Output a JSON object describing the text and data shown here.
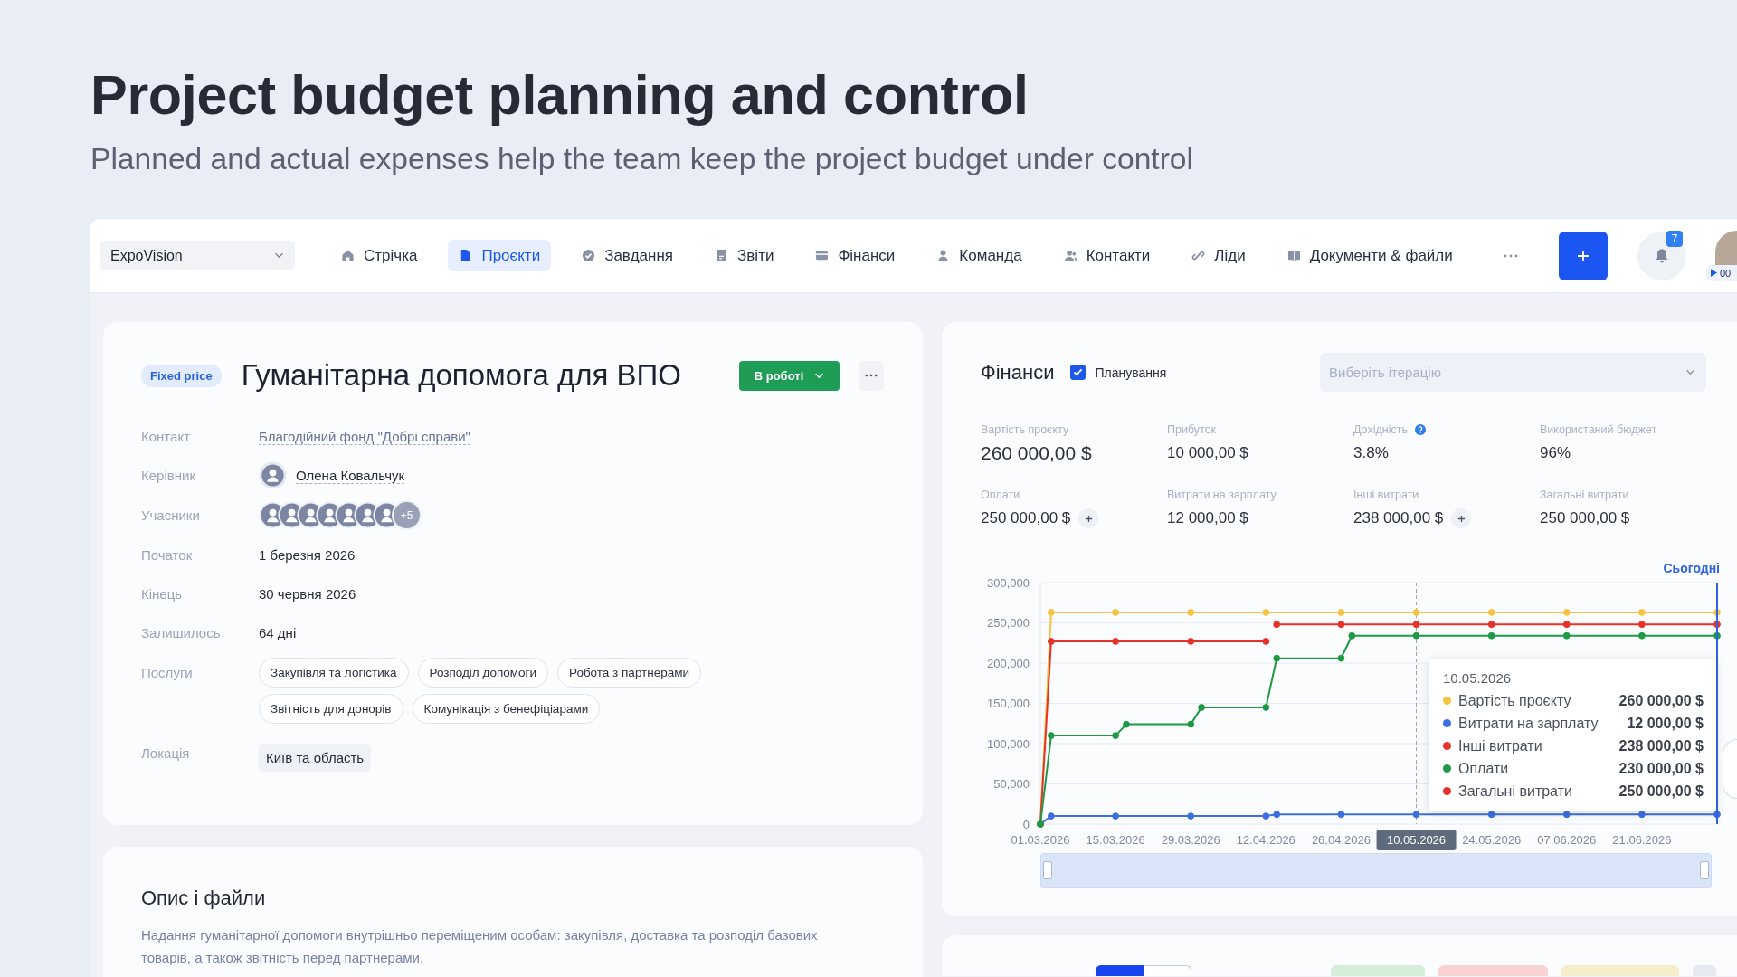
{
  "page": {
    "title": "Project budget planning and control",
    "subtitle": "Planned and actual expenses help the team keep the project budget under control"
  },
  "nav": {
    "workspace": "ExpoVision",
    "items": [
      {
        "label": "Стрічка",
        "selected": false
      },
      {
        "label": "Проєкти",
        "selected": true
      },
      {
        "label": "Завдання",
        "selected": false
      },
      {
        "label": "Звіти",
        "selected": false
      },
      {
        "label": "Фінанси",
        "selected": false
      },
      {
        "label": "Команда",
        "selected": false
      },
      {
        "label": "Контакти",
        "selected": false
      },
      {
        "label": "Ліди",
        "selected": false
      },
      {
        "label": "Документи & файли",
        "selected": false
      }
    ],
    "notifications": "7",
    "timer": "00"
  },
  "project": {
    "pricing": "Fixed price",
    "title": "Гуманітарна допомога для ВПО",
    "status": "В роботі",
    "fields": [
      {
        "label": "Контакт",
        "kind": "link",
        "value": "Благодійний фонд \"Добрі справи\""
      },
      {
        "label": "Керівник",
        "kind": "person",
        "value": "Олена Ковальчук"
      },
      {
        "label": "Учасники",
        "kind": "members",
        "avatars": [
          {
            "kind": "placeholder"
          },
          {
            "kind": "placeholder"
          },
          {
            "kind": "placeholder"
          },
          {
            "kind": "placeholder"
          },
          {
            "kind": "placeholder"
          },
          {
            "kind": "placeholder"
          },
          {
            "kind": "placeholder"
          },
          {
            "kind": "more",
            "label": "+5"
          }
        ]
      },
      {
        "label": "Початок",
        "kind": "text",
        "value": "1 березня 2026"
      },
      {
        "label": "Кінець",
        "kind": "text",
        "value": "30 червня 2026"
      },
      {
        "label": "Залишилось",
        "kind": "text",
        "value": "64 дні"
      },
      {
        "label": "Послуги",
        "kind": "tags",
        "tags": [
          "Закупівля та логістика",
          "Розподіл допомоги",
          "Робота з партнерами",
          "Звітність для донорів",
          "Комунікація з бенефіціарами"
        ]
      },
      {
        "label": "Локація",
        "kind": "location",
        "value": "Київ та область"
      }
    ]
  },
  "description": {
    "title": "Опис і файли",
    "text": "Надання гуманітарної допомоги внутрішньо переміщеним особам: закупівля, доставка та розподіл базових товарів, а також звітність перед партнерами."
  },
  "finance": {
    "title": "Фінанси",
    "planning": {
      "label": "Планування",
      "checked": true
    },
    "iteration": {
      "placeholder": "Виберіть ітерацію"
    },
    "stats": [
      {
        "label": "Вартість проєкту",
        "value": "260 000,00 $",
        "primary": true,
        "help": false,
        "add": false
      },
      {
        "label": "Прибуток",
        "value": "10 000,00 $",
        "primary": false,
        "help": false,
        "add": false
      },
      {
        "label": "Дохідність",
        "value": "3.8%",
        "primary": false,
        "help": true,
        "add": false
      },
      {
        "label": "Використаний бюджет",
        "value": "96%",
        "primary": false,
        "help": false,
        "add": false
      },
      {
        "label": "Оплати",
        "value": "250 000,00 $",
        "primary": false,
        "help": false,
        "add": true
      },
      {
        "label": "Витрати на зарплату",
        "value": "12 000,00 $",
        "primary": false,
        "help": false,
        "add": false
      },
      {
        "label": "Інші витрати",
        "value": "238 000,00 $",
        "primary": false,
        "help": false,
        "add": true
      },
      {
        "label": "Загальні витрати",
        "value": "250 000,00 $",
        "primary": false,
        "help": false,
        "add": false
      }
    ],
    "today_marker": {
      "label": "Сьогодні"
    },
    "chart_data": {
      "type": "line",
      "grid": true,
      "legend": "right",
      "categories": [
        "01.03.2026",
        null,
        null,
        null,
        null,
        null,
        null,
        "15.03.2026",
        null,
        null,
        null,
        null,
        null,
        null,
        "29.03.2026",
        null,
        null,
        null,
        null,
        null,
        null,
        "12.04.2026",
        null,
        null,
        null,
        null,
        null,
        null,
        "26.04.2026",
        null,
        null,
        null,
        null,
        null,
        null,
        "10.05.2026",
        null,
        null,
        null,
        null,
        null,
        null,
        "24.05.2026",
        null,
        null,
        null,
        null,
        null,
        null,
        "07.06.2026",
        null,
        null,
        null,
        null,
        null,
        null,
        "21.06.2026",
        null,
        null,
        null,
        null,
        null,
        null,
        null
      ],
      "ylim": [
        0,
        300000
      ],
      "yticks": [
        {
          "value": 0,
          "label": "0"
        },
        {
          "value": 50000,
          "label": "50,000"
        },
        {
          "value": 100000,
          "label": "100,000"
        },
        {
          "value": 150000,
          "label": "150,000"
        },
        {
          "value": 200000,
          "label": "200,000"
        },
        {
          "value": 250000,
          "label": "250,000"
        },
        {
          "value": 300000,
          "label": "300,000"
        }
      ],
      "series": [
        {
          "name": "Вартість проєкту",
          "color": "#f5c542",
          "values": [
            0,
            263000,
            263000,
            263000,
            263000,
            263000,
            263000,
            263000,
            263000,
            263000,
            263000,
            263000,
            263000,
            263000,
            263000,
            263000,
            263000,
            263000,
            263000,
            263000,
            263000,
            263000,
            263000,
            263000,
            263000,
            263000,
            263000,
            263000,
            263000,
            263000,
            263000,
            263000,
            263000,
            263000,
            263000,
            263000,
            263000,
            263000,
            263000,
            263000,
            263000,
            263000,
            263000,
            263000,
            263000,
            263000,
            263000,
            263000,
            263000,
            263000,
            263000,
            263000,
            263000,
            263000,
            263000,
            263000,
            263000,
            263000,
            263000,
            263000,
            263000,
            263000,
            263000,
            263000
          ]
        },
        {
          "name": "Витрати на зарплату",
          "color": "#3b6fe0",
          "values": [
            0,
            10000,
            10000,
            10000,
            10000,
            10000,
            10000,
            10000,
            10000,
            10000,
            10000,
            10000,
            10000,
            10000,
            10000,
            10000,
            10000,
            10000,
            10000,
            10000,
            10000,
            10000,
            12000,
            12000,
            12000,
            12000,
            12000,
            12000,
            12000,
            12000,
            12000,
            12000,
            12000,
            12000,
            12000,
            12000,
            12000,
            12000,
            12000,
            12000,
            12000,
            12000,
            12000,
            12000,
            12000,
            12000,
            12000,
            12000,
            12000,
            12000,
            12000,
            12000,
            12000,
            12000,
            12000,
            12000,
            12000,
            12000,
            12000,
            12000,
            12000,
            12000,
            12000,
            12000
          ]
        },
        {
          "name": "Інші витрати",
          "color": "#e5332a",
          "values": [
            0,
            227000,
            227000,
            227000,
            227000,
            227000,
            227000,
            227000,
            227000,
            227000,
            227000,
            227000,
            227000,
            227000,
            227000,
            227000,
            227000,
            227000,
            227000,
            227000,
            227000,
            227000,
            null,
            null,
            null,
            null,
            null,
            null,
            null,
            null,
            null,
            null,
            null,
            null,
            null,
            null,
            null,
            null,
            null,
            null,
            null,
            null,
            null,
            null,
            null,
            null,
            null,
            null,
            null,
            null,
            null,
            null,
            null,
            null,
            null,
            null,
            null,
            null,
            null,
            null,
            null,
            null,
            null,
            null
          ]
        },
        {
          "name": "Оплати",
          "color": "#1e9a45",
          "values": [
            0,
            110000,
            110000,
            110000,
            110000,
            110000,
            110000,
            110000,
            124000,
            124000,
            124000,
            124000,
            124000,
            124000,
            124000,
            145000,
            145000,
            145000,
            145000,
            145000,
            145000,
            145000,
            206000,
            206000,
            206000,
            206000,
            206000,
            206000,
            206000,
            234000,
            234000,
            234000,
            234000,
            234000,
            234000,
            234000,
            234000,
            234000,
            234000,
            234000,
            234000,
            234000,
            234000,
            234000,
            234000,
            234000,
            234000,
            234000,
            234000,
            234000,
            234000,
            234000,
            234000,
            234000,
            234000,
            234000,
            234000,
            234000,
            234000,
            234000,
            234000,
            234000,
            234000,
            234000
          ]
        },
        {
          "name": "Загальні витрати",
          "color": "#e5332a",
          "values": [
            null,
            null,
            null,
            null,
            null,
            null,
            null,
            null,
            null,
            null,
            null,
            null,
            null,
            null,
            null,
            null,
            null,
            null,
            null,
            null,
            null,
            null,
            248000,
            248000,
            248000,
            248000,
            248000,
            248000,
            248000,
            248000,
            248000,
            248000,
            248000,
            248000,
            248000,
            248000,
            248000,
            248000,
            248000,
            248000,
            248000,
            248000,
            248000,
            248000,
            248000,
            248000,
            248000,
            248000,
            248000,
            248000,
            248000,
            248000,
            248000,
            248000,
            248000,
            248000,
            248000,
            248000,
            248000,
            248000,
            248000,
            248000,
            248000,
            248000
          ]
        }
      ],
      "annotations": [
        {
          "x": "10.05.2026"
        }
      ]
    },
    "tooltip": {
      "date": "10.05.2026",
      "values": [
        "260 000,00 $",
        "12 000,00 $",
        "238 000,00 $",
        "230 000,00 $",
        "250 000,00 $"
      ]
    },
    "zoom_slider": {
      "level": 1
    }
  },
  "bottom_panel": {
    "view_toggle": [
      {
        "selected": true
      },
      {
        "selected": false
      }
    ],
    "tags": [
      {
        "color": "#d6edd9"
      },
      {
        "color": "#f9d2d2"
      },
      {
        "color": "#f6eecb"
      },
      {
        "color": "#e6e9ef"
      }
    ]
  }
}
